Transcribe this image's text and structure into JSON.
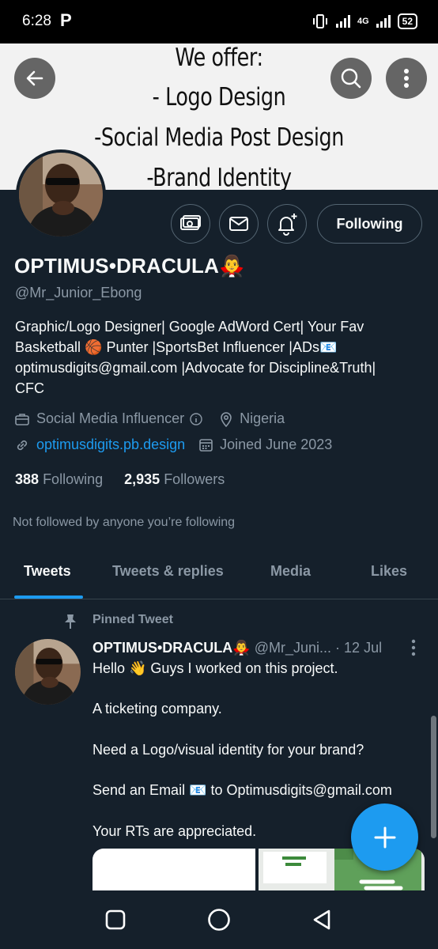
{
  "status_bar": {
    "time": "6:28",
    "carrier_icon": "P",
    "network": "4G",
    "battery": "52"
  },
  "banner": {
    "lines": [
      "We offer:",
      "- Logo Design",
      "-Social Media Post Design",
      "-Brand Identity"
    ],
    "back_icon": "arrow-left-icon",
    "search_icon": "search-icon",
    "more_icon": "more-vertical-icon"
  },
  "profile": {
    "name": "OPTIMUS•DRACULA🧛‍♂️",
    "handle": "@Mr_Junior_Ebong",
    "bio_lines": [
      "Graphic/Logo Designer| Google AdWord Cert| Your Fav",
      "Basketball 🏀 Punter |SportsBet Influencer |ADs📧",
      "optimusdigits@gmail.com |Advocate for Discipline&Truth|",
      "CFC"
    ],
    "category": "Social Media Influencer",
    "location": "Nigeria",
    "website": "optimusdigits.pb.design",
    "joined": "Joined June 2023",
    "following_count": "388",
    "following_label": "Following",
    "followers_count": "2,935",
    "followers_label": "Followers",
    "not_followed_text": "Not followed by anyone you’re following",
    "follow_button": "Following"
  },
  "tabs": [
    "Tweets",
    "Tweets & replies",
    "Media",
    "Likes"
  ],
  "active_tab": "Tweets",
  "tweet": {
    "pinned_label": "Pinned Tweet",
    "author": "OPTIMUS•DRACULA🧛‍♂️",
    "handle": "@Mr_Juni...",
    "date": "· 12 Jul",
    "lines": [
      "Hello 👋 Guys I worked on this project.",
      "A ticketing company.",
      "Need a Logo/visual identity for your brand?",
      "Send an Email 📧 to Optimusdigits@gmail.com",
      "Your RTs are appreciated."
    ]
  },
  "colors": {
    "accent": "#1d9bf0",
    "background": "#15202b",
    "muted": "#8b98a5",
    "border": "#536471"
  }
}
